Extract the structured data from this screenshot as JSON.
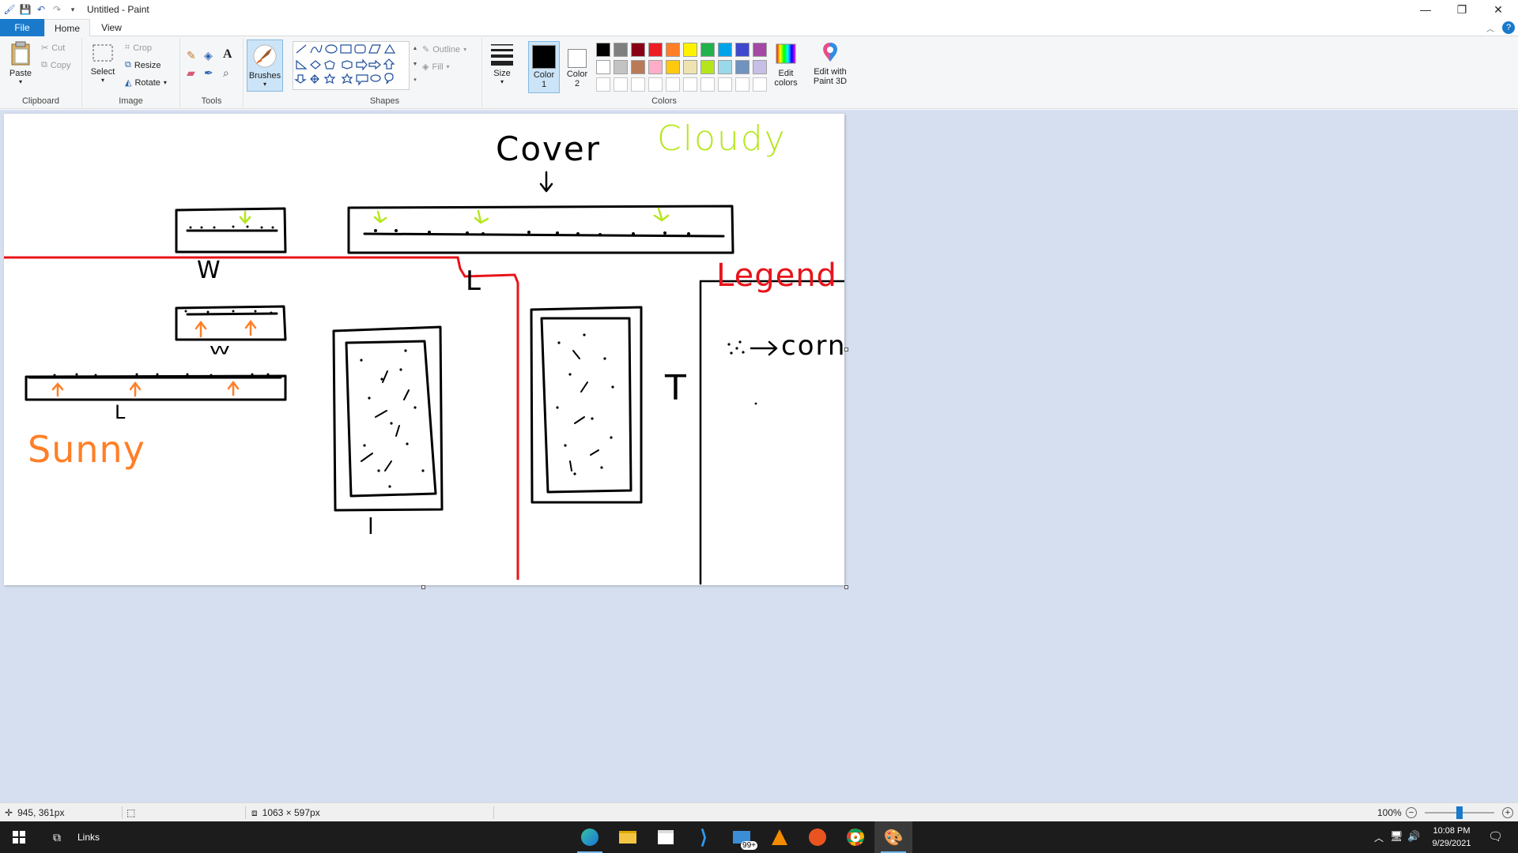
{
  "window": {
    "title": "Untitled - Paint"
  },
  "tabs": [
    {
      "label": "File"
    },
    {
      "label": "Home"
    },
    {
      "label": "View"
    }
  ],
  "ribbon": {
    "clipboard": {
      "paste": "Paste",
      "cut": "Cut",
      "copy": "Copy",
      "label": "Clipboard"
    },
    "image": {
      "select": "Select",
      "crop": "Crop",
      "resize": "Resize",
      "rotate": "Rotate",
      "label": "Image"
    },
    "tools": {
      "label": "Tools"
    },
    "brushes": {
      "label": "Brushes"
    },
    "shapes": {
      "outline": "Outline",
      "fill": "Fill",
      "label": "Shapes"
    },
    "size": {
      "label": "Size"
    },
    "colors": {
      "color1": "Color 1",
      "color2": "Color 2",
      "edit_colors": "Edit colors",
      "label": "Colors",
      "color1_value": "#000000",
      "color2_value": "#ffffff",
      "palette_row1": [
        "#000000",
        "#7f7f7f",
        "#880015",
        "#ed1c24",
        "#ff7f27",
        "#fff200",
        "#22b14c",
        "#00a2e8",
        "#3f48cc",
        "#a349a4"
      ],
      "palette_row2": [
        "#ffffff",
        "#c3c3c3",
        "#b97a57",
        "#ffaec9",
        "#ffc90e",
        "#efe4b0",
        "#b5e61d",
        "#99d9ea",
        "#7092be",
        "#c8bfe7"
      ]
    },
    "paint3d": {
      "label": "Edit with Paint 3D"
    }
  },
  "drawing": {
    "cover": "Cover",
    "cloudy": "Cloudy",
    "sunny": "Sunny",
    "legend": "Legend",
    "corn": "corn",
    "w1": "W",
    "w2": "W",
    "l_top": "L",
    "l_left": "L",
    "l_mid": "l",
    "t_right": "T",
    "colors": {
      "red": "#e8131b",
      "orange": "#ff7f27",
      "green": "#b5e61d",
      "black": "#000000"
    }
  },
  "statusbar": {
    "cursor_pos": "945, 361px",
    "canvas_size": "1063 × 597px",
    "zoom": "100%",
    "zoom_fraction": 0.5
  },
  "taskbar": {
    "links": "Links",
    "time": "10:08 PM",
    "date": "9/29/2021",
    "badge": "99+"
  }
}
